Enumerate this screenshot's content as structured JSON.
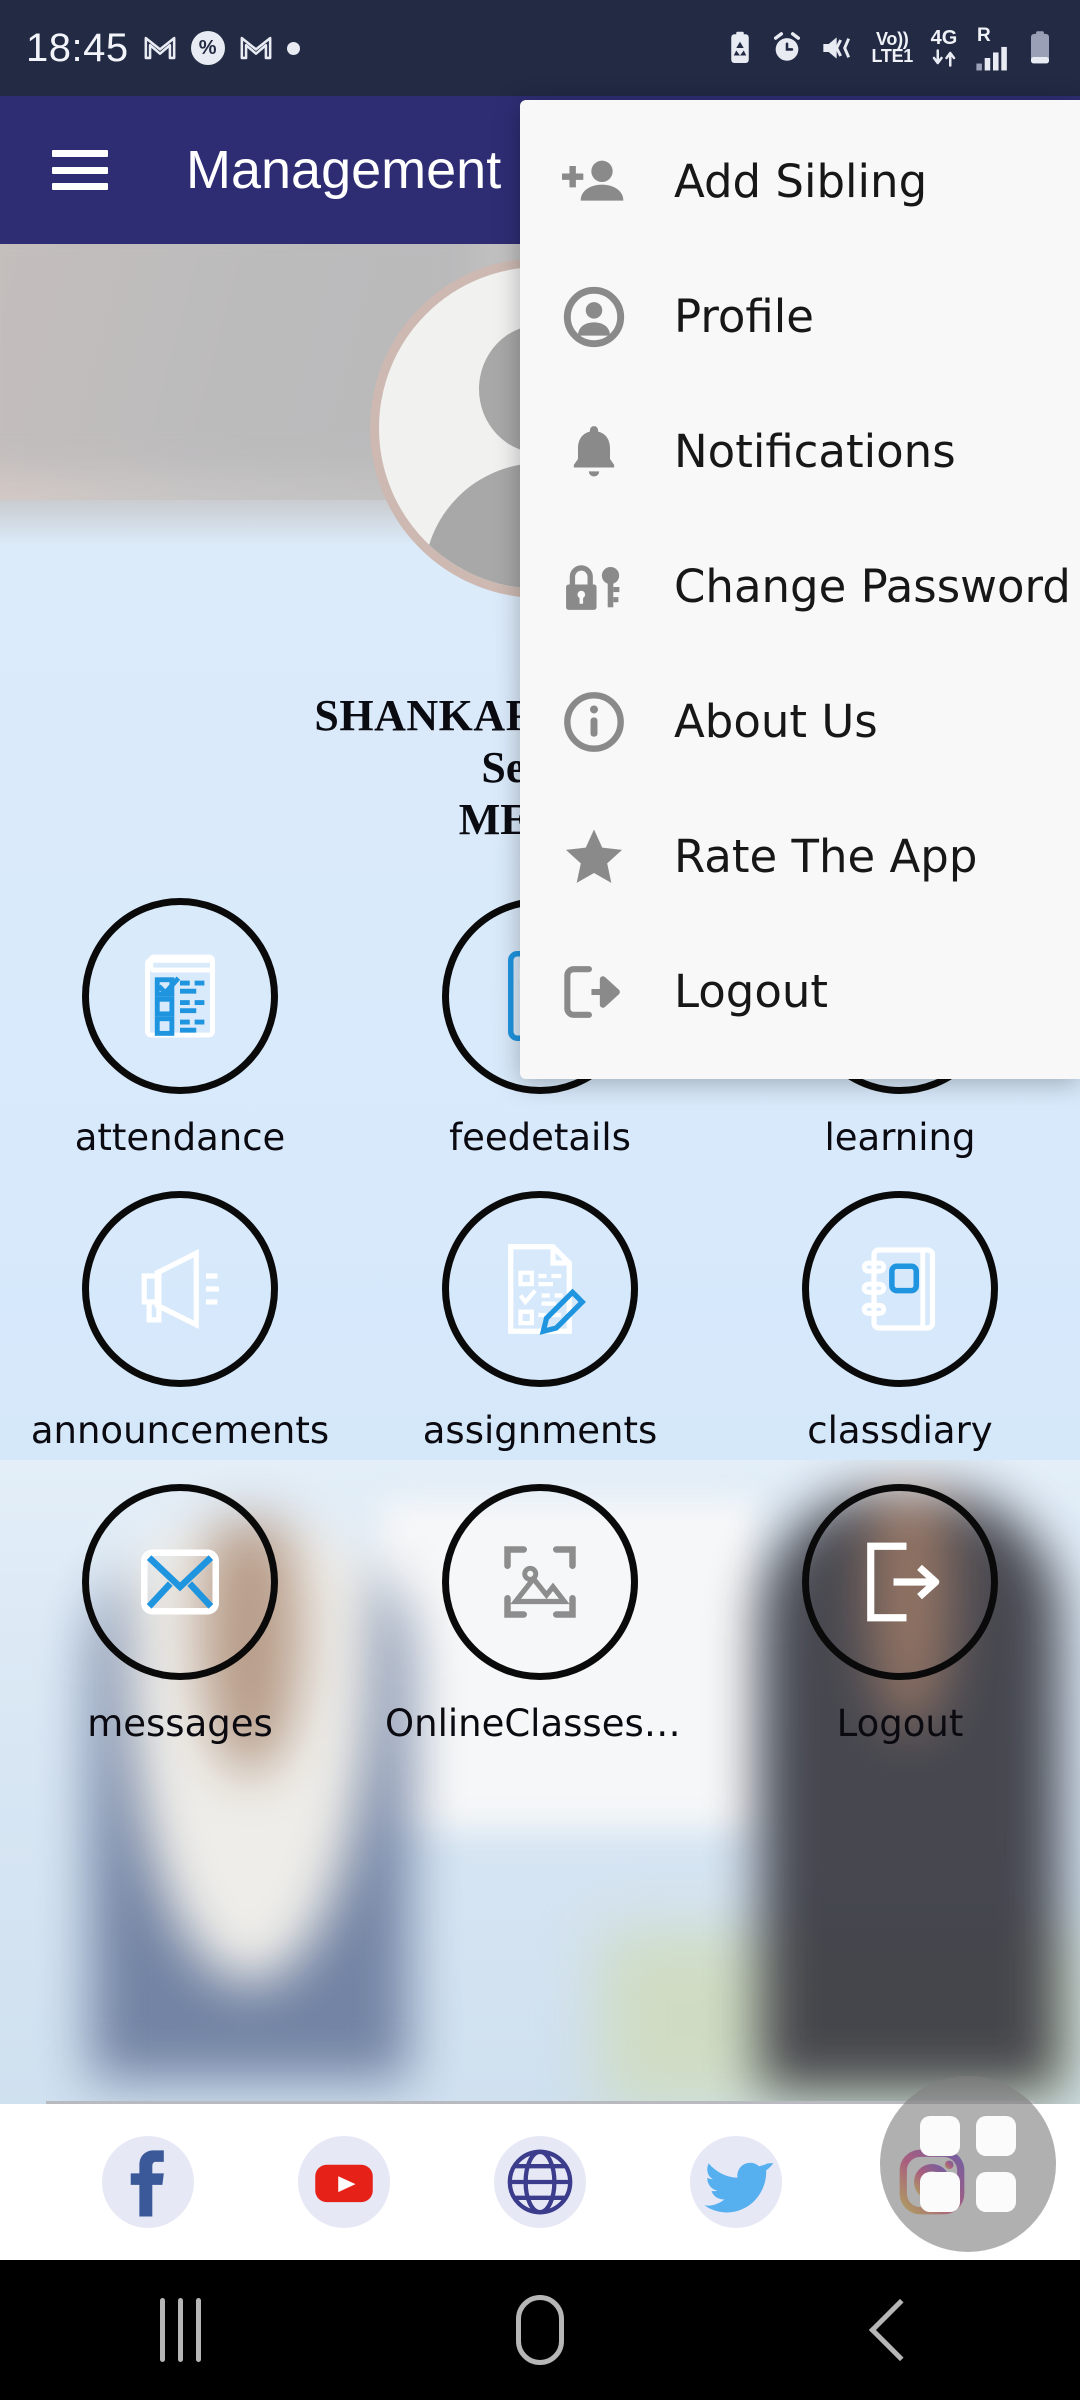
{
  "status_bar": {
    "time": "18:45",
    "left_icons": [
      "gmail-icon",
      "app-badge-icon",
      "gmail-icon",
      "dot-indicator-icon"
    ],
    "right_icons": [
      "battery-saver-icon",
      "alarm-icon",
      "vibrate-icon",
      "volte-icon",
      "4g-data-icon",
      "roaming-signal-icon",
      "battery-icon"
    ],
    "volte_top": "Vo))",
    "volte_bottom": "LTE1",
    "network": "4G",
    "roaming": "R"
  },
  "appbar": {
    "menu_icon": "hamburger-icon",
    "title": "Management"
  },
  "student": {
    "avatar_icon": "default-avatar-icon",
    "name": "SHANKARSHAN  SHA",
    "semester": "Semes",
    "organisation": "MERI C"
  },
  "grid": {
    "tiles": [
      {
        "label": "attendance",
        "icon": "checklist-icon"
      },
      {
        "label": "feedetails",
        "icon": "calculator-icon"
      },
      {
        "label": "learning",
        "icon": "learning-icon"
      },
      {
        "label": "announcements",
        "icon": "megaphone-icon"
      },
      {
        "label": "assignments",
        "icon": "document-pencil-icon"
      },
      {
        "label": "classdiary",
        "icon": "notebook-icon"
      },
      {
        "label": "messages",
        "icon": "envelope-icon"
      },
      {
        "label": "OnlineClasses(Ha...",
        "icon": "image-frame-icon"
      },
      {
        "label": "Logout",
        "icon": "logout-icon"
      }
    ]
  },
  "social": {
    "items": [
      {
        "name": "facebook-icon",
        "label": "Facebook",
        "color": "#3b5998"
      },
      {
        "name": "youtube-icon",
        "label": "YouTube",
        "color": "#e62117"
      },
      {
        "name": "website-icon",
        "label": "Website",
        "color": "#3c3c8c"
      },
      {
        "name": "twitter-icon",
        "label": "Twitter",
        "color": "#56b0ef"
      },
      {
        "name": "instagram-icon",
        "label": "Instagram",
        "color": "#d62976"
      }
    ]
  },
  "fab": {
    "icon": "grid-apps-icon"
  },
  "menu": {
    "items": [
      {
        "label": "Add Sibling",
        "icon": "add-person-icon"
      },
      {
        "label": "Profile",
        "icon": "profile-circle-icon"
      },
      {
        "label": "Notifications",
        "icon": "bell-icon"
      },
      {
        "label": "Change Password",
        "icon": "lock-key-icon"
      },
      {
        "label": "About Us",
        "icon": "info-circle-icon"
      },
      {
        "label": "Rate The App",
        "icon": "star-icon"
      },
      {
        "label": "Logout",
        "icon": "logout-arrow-icon"
      }
    ]
  },
  "navbar": {
    "recents": "recents-button",
    "home": "home-button",
    "back": "back-button"
  },
  "colors": {
    "statusbar": "#222a44",
    "appbar": "#2e2d74",
    "content": "#d7e9fb",
    "menu_bg": "#f8f8f8",
    "icon_accent": "#1f95e0",
    "navbar": "#000000"
  }
}
